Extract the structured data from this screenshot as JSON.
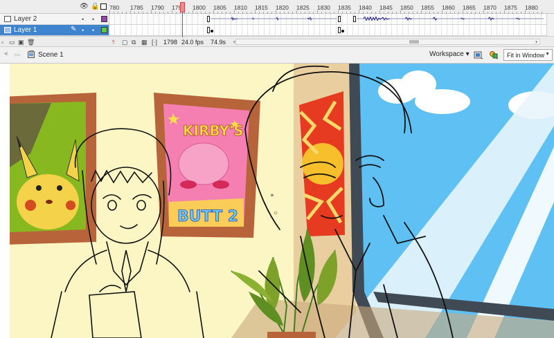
{
  "timeline": {
    "ruler_labels": [
      "780",
      "1785",
      "1790",
      "1795",
      "1800",
      "1805",
      "1810",
      "1815",
      "1820",
      "1825",
      "1830",
      "1835",
      "1840",
      "1845",
      "1850",
      "1855",
      "1860",
      "1865",
      "1870",
      "1875",
      "1880"
    ],
    "header_icons": {
      "eye": "eye-icon",
      "lock": "lock-icon",
      "outline": "outline-square-icon"
    },
    "layers": [
      {
        "name": "Layer 2",
        "color": "#9b3fbd",
        "selected": false
      },
      {
        "name": "Layer 1",
        "color": "#4ed24a",
        "selected": true
      }
    ],
    "footer": {
      "current_frame": "1798",
      "frame_rate": "24.0 fps",
      "elapsed_time": "74.9s"
    },
    "playhead_frame": 1798
  },
  "editbar": {
    "scene_label": "Scene 1",
    "workspace_label": "Workspace ▾",
    "zoom_value": "Fit in Window"
  },
  "stage": {
    "poster_title_top": "KIRBY'S",
    "poster_title_bottom": "BUTT 2",
    "colors": {
      "wall": "#fbf6c3",
      "frame": "#b8643a",
      "sky": "#5fc0f4"
    }
  }
}
